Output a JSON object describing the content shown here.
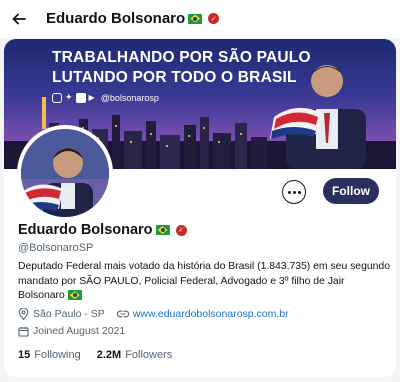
{
  "header": {
    "title": "Eduardo Bolsonaro",
    "back_icon": "arrow-left-icon",
    "flag_icon": "brazil-flag-icon",
    "badge_icon": "verified-badge-icon"
  },
  "banner": {
    "line1": "TRABALHANDO POR SÃO PAULO",
    "line2": "LUTANDO POR TODO O BRASIL",
    "handle": "@bolsonarosp",
    "social_icons": [
      "instagram-icon",
      "twitter-icon",
      "facebook-icon",
      "youtube-icon"
    ]
  },
  "actions": {
    "more_icon": "more-options-icon",
    "follow_label": "Follow",
    "follow_color": "#2b2f5e"
  },
  "profile": {
    "name": "Eduardo Bolsonaro",
    "handle": "@BolsonaroSP",
    "bio": "Deputado Federal mais votado da história do Brasil (1.843.735) em seu segundo mandato por SÃO PAULO, Policial Federal, Advogado e 3º filho de Jair Bolsonaro",
    "location": "São Paulo - SP",
    "website": "www.eduardobolsonarosp.com.br",
    "joined": "Joined August 2021"
  },
  "stats": {
    "following_count": "15",
    "following_label": "Following",
    "followers_count": "2.2M",
    "followers_label": "Followers"
  },
  "colors": {
    "link": "#1d6fd1",
    "muted": "#536471",
    "badge": "#c32a2a"
  }
}
